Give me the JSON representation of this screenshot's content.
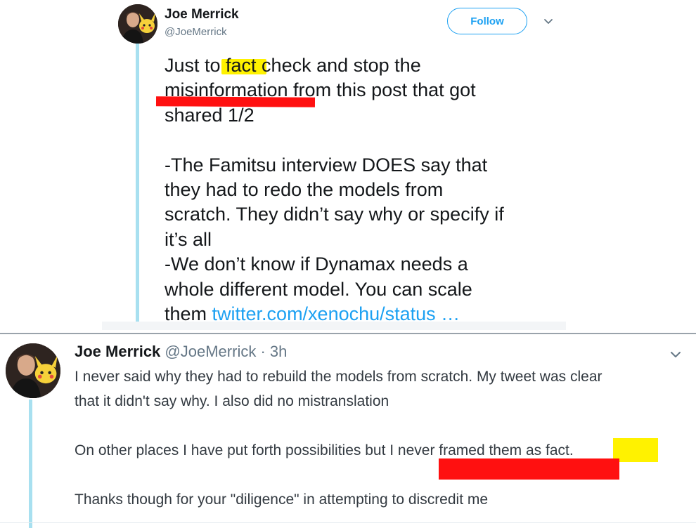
{
  "tweet_top": {
    "author_name": "Joe Merrick",
    "author_handle": "@JoeMerrick",
    "follow_label": "Follow",
    "caret_icon": "chevron-down-icon",
    "lines": [
      "Just to fact check and stop the",
      "misinformation from this post that got",
      "shared 1/2",
      "",
      "-The Famitsu interview DOES say that",
      "they had to redo the models from",
      "scratch. They didn’t say why or specify if",
      "it’s all",
      "-We don’t know if Dynamax needs a",
      "whole different model. You can scale"
    ],
    "last_line_prefix": "them ",
    "link_text": "twitter.com/xenochu/status …"
  },
  "tweet_bottom": {
    "author_name": "Joe Merrick",
    "author_handle": "@JoeMerrick",
    "separator": " · ",
    "time": "3h",
    "caret_icon": "chevron-down-icon",
    "lines": [
      "I never said why they had to rebuild the models from scratch. My tweet was clear",
      "that it didn't say why. I also did no mistranslation",
      "",
      "On other places I have put forth possibilities but I never framed them as fact.",
      "",
      "Thanks though for your \"diligence\" in attempting to discredit me"
    ]
  },
  "colors": {
    "accent": "#1da1f2",
    "thread_line": "#a8e0f0",
    "highlight": "#fff200",
    "annotation_red": "#ff1010",
    "muted": "#657786"
  }
}
